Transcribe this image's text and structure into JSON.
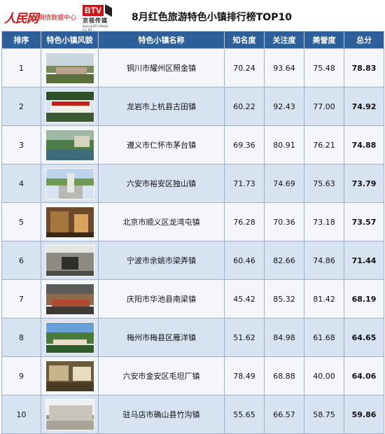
{
  "header": {
    "logo_people_brand": "人民网",
    "logo_people_sub": "舆情数据中心",
    "logo_btv_mark": "BTV",
    "logo_btv_cn": "京视传媒",
    "logo_btv_en": "Beijing BTV Media Co.,ltd",
    "title": "8月红色旅游特色小镇排行榜TOP10"
  },
  "table": {
    "columns": [
      "排序",
      "特色小镇风貌",
      "特色小镇名称",
      "知名度",
      "关注度",
      "美誉度",
      "总分"
    ],
    "rows": [
      {
        "rank": "1",
        "name": "铜川市耀州区照金镇",
        "fame": "70.24",
        "attention": "93.64",
        "reputation": "75.48",
        "total": "78.83",
        "photo": {
          "sky": "#c9d6dc",
          "mid": "#7a8a5a",
          "ground": "#5c6e3a",
          "bldg": "#b9a38a"
        }
      },
      {
        "rank": "2",
        "name": "龙岩市上杭县古田镇",
        "fame": "60.22",
        "attention": "92.43",
        "reputation": "77.00",
        "total": "74.92",
        "photo": {
          "sky": "#2f4f2a",
          "mid": "#f2efe6",
          "ground": "#3a5a34",
          "bldg": "#c2221c"
        }
      },
      {
        "rank": "3",
        "name": "遵义市仁怀市茅台镇",
        "fame": "69.36",
        "attention": "80.91",
        "reputation": "76.21",
        "total": "74.88",
        "photo": {
          "sky": "#9fb8a4",
          "mid": "#4d7d4a",
          "ground": "#3f6c7a",
          "bldg": "#d8d2c0"
        }
      },
      {
        "rank": "4",
        "name": "六安市裕安区独山镇",
        "fame": "71.73",
        "attention": "74.69",
        "reputation": "75.63",
        "total": "73.79",
        "photo": {
          "sky": "#bcd4ee",
          "mid": "#6e9a52",
          "ground": "#b9b9b4",
          "bldg": "#e8e8e2"
        }
      },
      {
        "rank": "5",
        "name": "北京市顺义区龙湾屯镇",
        "fame": "76.28",
        "attention": "70.36",
        "reputation": "73.18",
        "total": "73.57",
        "photo": {
          "sky": "#6e4a2c",
          "mid": "#a5773f",
          "ground": "#3a2716",
          "bldg": "#d9a35c"
        }
      },
      {
        "rank": "6",
        "name": "宁波市余姚市梁弄镇",
        "fame": "60.46",
        "attention": "82.66",
        "reputation": "74.86",
        "total": "71.44",
        "photo": {
          "sky": "#e4e4e0",
          "mid": "#8d8a82",
          "ground": "#4a4a46",
          "bldg": "#2e2e2c"
        }
      },
      {
        "rank": "7",
        "name": "庆阳市华池县南梁镇",
        "fame": "45.42",
        "attention": "85.32",
        "reputation": "81.42",
        "total": "68.19",
        "photo": {
          "sky": "#5a5a58",
          "mid": "#8b6b4b",
          "ground": "#3f3a34",
          "bldg": "#b04a32"
        }
      },
      {
        "rank": "8",
        "name": "梅州市梅县区雁洋镇",
        "fame": "51.62",
        "attention": "84.98",
        "reputation": "61.68",
        "total": "64.65",
        "photo": {
          "sky": "#6aa0d8",
          "mid": "#4a7a3c",
          "ground": "#2f5a2a",
          "bldg": "#e6dcc8"
        }
      },
      {
        "rank": "9",
        "name": "六安市金安区毛坦厂镇",
        "fame": "78.49",
        "attention": "68.88",
        "reputation": "40.00",
        "total": "64.06",
        "photo": {
          "sky": "#6a5a3a",
          "mid": "#c8b48a",
          "ground": "#4a3c24",
          "bldg": "#e8dcc0"
        }
      },
      {
        "rank": "10",
        "name": "驻马店市确山县竹沟镇",
        "fame": "55.65",
        "attention": "66.57",
        "reputation": "58.75",
        "total": "59.86",
        "photo": {
          "sky": "#eef2f4",
          "mid": "#8aa07a",
          "ground": "#a8a49a",
          "bldg": "#c8c4ba"
        }
      }
    ]
  },
  "colors": {
    "header_bg": "#2d5f9a",
    "row_odd": "#f4f6fa",
    "row_even": "#d8e3f1",
    "brand_red": "#d11212"
  }
}
